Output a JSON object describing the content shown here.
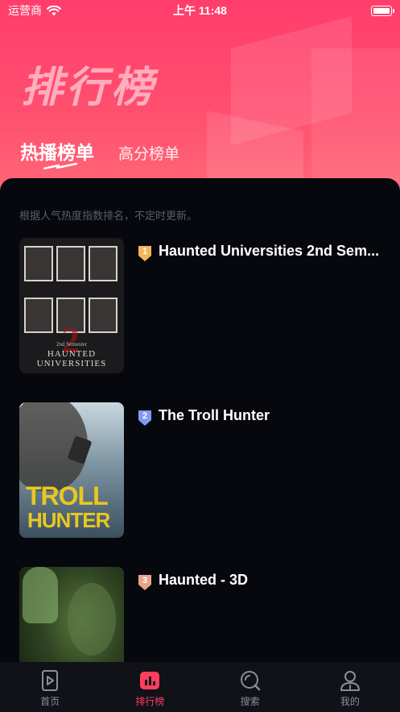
{
  "status_bar": {
    "carrier": "运营商",
    "time": "上午 11:48",
    "wifi_icon": "wifi-icon",
    "battery_icon": "battery-icon"
  },
  "header": {
    "title": "排行榜",
    "tabs": [
      {
        "label": "热播榜单",
        "active": true
      },
      {
        "label": "高分榜单",
        "active": false
      }
    ]
  },
  "ranking": {
    "description": "根据人气热度指数排名，不定时更新。",
    "items": [
      {
        "rank": "1",
        "title": "Haunted Universities 2nd Sem...",
        "badge_color": "#f4b65a",
        "poster_text": "HAUNTED UNIVERSITIES",
        "poster_subtext": "2nd Semester",
        "poster_numeral": "2"
      },
      {
        "rank": "2",
        "title": "The Troll Hunter",
        "badge_color": "#7f9bf5",
        "poster_line1": "TROLL",
        "poster_line2": "HUNTER"
      },
      {
        "rank": "3",
        "title": "Haunted - 3D",
        "badge_color": "#e8a48c"
      }
    ]
  },
  "tabbar": {
    "items": [
      {
        "label": "首页",
        "icon": "home-play-icon",
        "active": false
      },
      {
        "label": "排行榜",
        "icon": "ranking-chart-icon",
        "active": true
      },
      {
        "label": "搜索",
        "icon": "search-icon",
        "active": false
      },
      {
        "label": "我的",
        "icon": "profile-icon",
        "active": false
      }
    ]
  },
  "colors": {
    "accent": "#ff3d5e",
    "hero_gradient_top": "#ff3d6b",
    "background": "#07080d"
  }
}
